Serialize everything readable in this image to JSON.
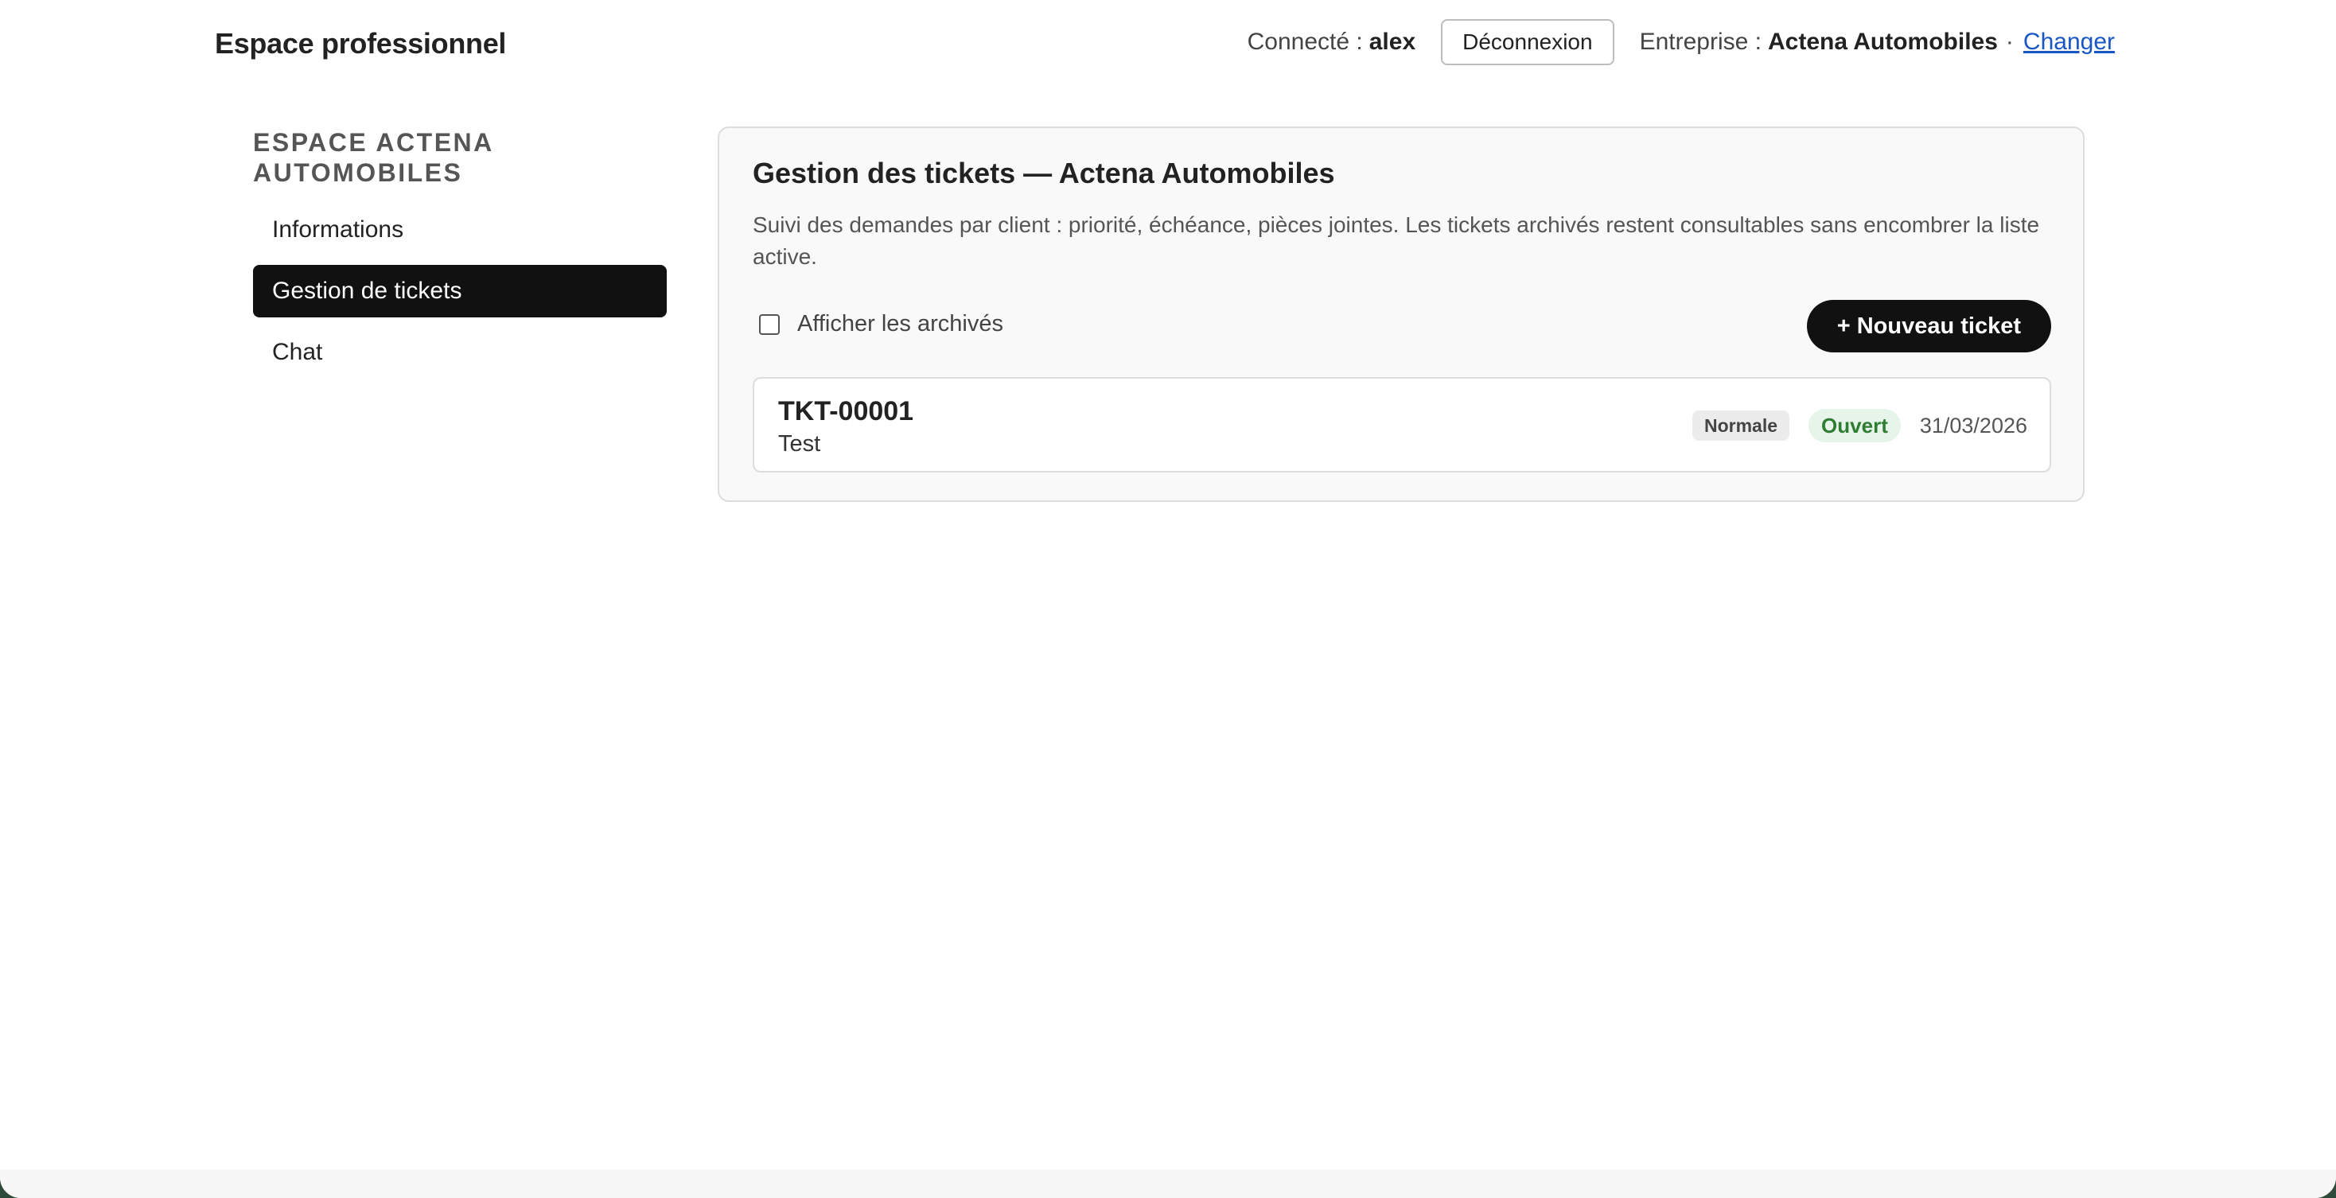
{
  "header": {
    "app_title": "Espace professionnel",
    "connected_label": "Connecté :",
    "username": "alex",
    "logout_label": "Déconnexion",
    "company_label": "Entreprise :",
    "company_name": "Actena Automobiles",
    "separator": "·",
    "change_label": "Changer"
  },
  "sidebar": {
    "heading": "ESPACE ACTENA AUTOMOBILES",
    "items": [
      {
        "label": "Informations",
        "active": false
      },
      {
        "label": "Gestion de tickets",
        "active": true
      },
      {
        "label": "Chat",
        "active": false
      }
    ]
  },
  "main": {
    "title": "Gestion des tickets — Actena Automobiles",
    "description": "Suivi des demandes par client : priorité, échéance, pièces jointes. Les tickets archivés restent consultables sans encombrer la liste active.",
    "show_archived_label": "Afficher les archivés",
    "show_archived_checked": false,
    "new_ticket_label": "+ Nouveau ticket",
    "tickets": [
      {
        "id": "TKT-00001",
        "subject": "Test",
        "priority": "Normale",
        "status": "Ouvert",
        "date": "31/03/2026"
      }
    ]
  },
  "colors": {
    "accent": "#111111",
    "link": "#1a56c4",
    "status_open_text": "#2e7d32",
    "status_open_bg": "#e6f4ea"
  }
}
